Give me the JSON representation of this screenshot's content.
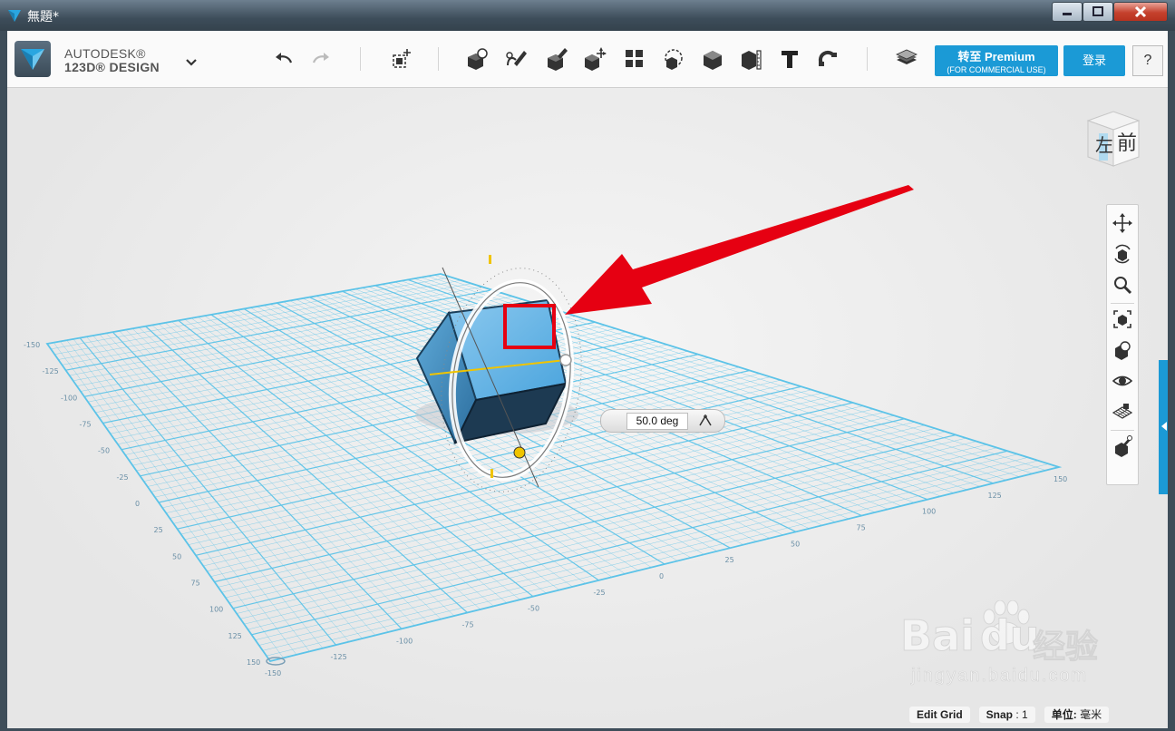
{
  "window": {
    "title": "無題*",
    "controls": {
      "minimize": "minimize",
      "maximize": "maximize",
      "close": "close"
    }
  },
  "toolbar": {
    "brand_line1": "AUTODESK®",
    "brand_line2": "123D® DESIGN",
    "icons": [
      "undo-icon",
      "redo-icon",
      "transform-icon",
      "primitives-icon",
      "sketch-icon",
      "construct-icon",
      "modify-icon",
      "pattern-icon",
      "grouping-icon",
      "combine-icon",
      "measure-icon",
      "text-icon",
      "snap-icon",
      "materials-icon"
    ],
    "premium_label": "转至 Premium",
    "premium_sublabel": "(FOR COMMERCIAL USE)",
    "login_label": "登录",
    "help_label": "?"
  },
  "viewcube": {
    "left_face": "左",
    "front_face": "前"
  },
  "navbar": {
    "icons": [
      "pan-icon",
      "orbit-icon",
      "zoom-icon",
      "fit-icon",
      "view-mode-icon",
      "visibility-icon",
      "grid-icon",
      "material-icon"
    ]
  },
  "rotate_widget": {
    "angle_value": "50.0 deg"
  },
  "grid": {
    "line_color": "#5cc3e8",
    "labels": [
      "-150",
      "-125",
      "-100",
      "-75",
      "-50",
      "-25",
      "0",
      "25",
      "50",
      "75",
      "100",
      "125",
      "150"
    ]
  },
  "statusbar": {
    "edit_grid": "Edit Grid",
    "snap_label": "Snap",
    "snap_value": "1",
    "unit_label": "单位:",
    "unit_value": "毫米"
  },
  "watermark": {
    "brand": "Bai",
    "brand2": "du",
    "product": "经验",
    "url": "jingyan.baidu.com"
  },
  "colors": {
    "accent": "#1b9ad6",
    "grid": "#5cc3e8",
    "annotation": "#e60012",
    "cube": "#4a9fd8"
  }
}
